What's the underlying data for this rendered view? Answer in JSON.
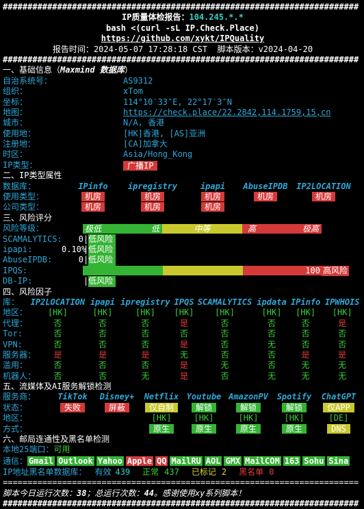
{
  "header": {
    "title_prefix": "IP质量体检报告：",
    "ip": "104.245.*.*",
    "cmd": "bash <(curl -sL IP.Check.Place)",
    "repo": "https://github.com/xykt/IPQuality",
    "report_time_label": "报告时间：",
    "report_time": "2024-05-07 17:28:18 CST",
    "version_label": "脚本版本：",
    "version": "v2024-04-20"
  },
  "basic": {
    "title": "一、基础信息（",
    "title_em": "Maxmind 数据库",
    "title_end": "）",
    "rows": [
      {
        "label": "自治系统号：",
        "value": "AS9312"
      },
      {
        "label": "组织：",
        "value": "xTom"
      },
      {
        "label": "坐标：",
        "value": "114°10′33″E, 22°17′3″N"
      },
      {
        "label": "地图：",
        "value": "https://check.place/22.2842,114.1759,15,cn"
      },
      {
        "label": "城市：",
        "value": "N/A, 香港"
      },
      {
        "label": "使用地：",
        "value": "[HK]香港, [AS]亚洲"
      },
      {
        "label": "注册地：",
        "value": "[CA]加拿大"
      },
      {
        "label": "时区：",
        "value": "Asia/Hong_Kong"
      },
      {
        "label": "IP类型：",
        "value": "广播IP"
      }
    ]
  },
  "iptype": {
    "title": "二、IP类型属性",
    "db_label": "数据库：",
    "dbs": [
      "IPinfo",
      "ipregistry",
      "ipapi",
      "AbuseIPDB",
      "IP2LOCATION"
    ],
    "use_label": "使用类型：",
    "use": [
      "机房",
      "机房",
      "机房",
      "机房",
      "机房"
    ],
    "company_label": "公司类型：",
    "company": [
      "机房",
      "机房",
      "机房",
      "",
      ""
    ]
  },
  "risk": {
    "title": "三、风险评分",
    "level_label": "风险等级：",
    "levels": [
      "极低",
      "低",
      "中等",
      "高",
      "极高"
    ],
    "rows": [
      {
        "label": "SCAMALYTICS:",
        "num": "0",
        "text": "低风险",
        "fill": 0.0
      },
      {
        "label": "ipapi:",
        "num": "0.10%",
        "text": "低风险",
        "fill": 0.001
      },
      {
        "label": "AbuseIPDB:",
        "num": "0",
        "text": "低风险",
        "fill": 0.0
      },
      {
        "label": "IPQS:",
        "num": "100",
        "text": "高风险",
        "fill": 1.0
      },
      {
        "label": "DB-IP:",
        "num": "",
        "text": "低风险",
        "fill": 0.0
      }
    ]
  },
  "factors": {
    "title": "四、风险因子",
    "lib_label": "库：",
    "cols": [
      "IP2LOCATION",
      "ipapi",
      "ipregistry",
      "IPQS",
      "SCAMALYTICS",
      "ipdata",
      "IPinfo",
      "IPWHOIS"
    ],
    "rows": [
      {
        "label": "地区：",
        "cells": [
          [
            "[HK]",
            "g"
          ],
          [
            "[HK]",
            "g"
          ],
          [
            "[HK]",
            "g"
          ],
          [
            "[HK]",
            "g"
          ],
          [
            "[HK]",
            "g"
          ],
          [
            "[HK]",
            "g"
          ],
          [
            "[HK]",
            "g"
          ],
          [
            "[HK]",
            "g"
          ]
        ]
      },
      {
        "label": "代理：",
        "cells": [
          [
            "否",
            "g"
          ],
          [
            "否",
            "g"
          ],
          [
            "否",
            "g"
          ],
          [
            "是",
            "r"
          ],
          [
            "否",
            "g"
          ],
          [
            "否",
            "g"
          ],
          [
            "否",
            "g"
          ],
          [
            "是",
            "r"
          ]
        ]
      },
      {
        "label": "Tor:",
        "cells": [
          [
            "否",
            "g"
          ],
          [
            "否",
            "g"
          ],
          [
            "否",
            "g"
          ],
          [
            "否",
            "g"
          ],
          [
            "否",
            "g"
          ],
          [
            "否",
            "g"
          ],
          [
            "否",
            "g"
          ],
          [
            "否",
            "g"
          ]
        ]
      },
      {
        "label": "VPN:",
        "cells": [
          [
            "否",
            "g"
          ],
          [
            "否",
            "g"
          ],
          [
            "否",
            "g"
          ],
          [
            "是",
            "r"
          ],
          [
            "否",
            "g"
          ],
          [
            "无",
            "g"
          ],
          [
            "否",
            "g"
          ],
          [
            "否",
            "g"
          ]
        ]
      },
      {
        "label": "服务器：",
        "cells": [
          [
            "是",
            "r"
          ],
          [
            "是",
            "r"
          ],
          [
            "是",
            "r"
          ],
          [
            "无",
            "g"
          ],
          [
            "否",
            "g"
          ],
          [
            "否",
            "g"
          ],
          [
            "是",
            "r"
          ],
          [
            "是",
            "r"
          ]
        ]
      },
      {
        "label": "滥用：",
        "cells": [
          [
            "否",
            "g"
          ],
          [
            "否",
            "g"
          ],
          [
            "否",
            "g"
          ],
          [
            "是",
            "r"
          ],
          [
            "无",
            "g"
          ],
          [
            "否",
            "g"
          ],
          [
            "无",
            "g"
          ],
          [
            "无",
            "g"
          ]
        ]
      },
      {
        "label": "机器人：",
        "cells": [
          [
            "否",
            "g"
          ],
          [
            "否",
            "g"
          ],
          [
            "无",
            "g"
          ],
          [
            "是",
            "r"
          ],
          [
            "否",
            "g"
          ],
          [
            "无",
            "g"
          ],
          [
            "无",
            "g"
          ],
          [
            "无",
            "g"
          ]
        ]
      }
    ]
  },
  "stream": {
    "title": "五、流媒体及AI服务解锁检测",
    "svc_label": "服务商：",
    "services": [
      "TikTok",
      "Disney+",
      "Netflix",
      "Youtube",
      "AmazonPV",
      "Spotify",
      "ChatGPT"
    ],
    "status_label": "状态：",
    "status": [
      [
        "失败",
        "red"
      ],
      [
        "屏蔽",
        "red"
      ],
      [
        "仅自制",
        "yellow"
      ],
      [
        "解锁",
        "green"
      ],
      [
        "解锁",
        "green"
      ],
      [
        "解锁",
        "green"
      ],
      [
        "仅APP",
        "yellow"
      ]
    ],
    "region_label": "地区：",
    "region": [
      "",
      "",
      "[HK]",
      "[HK]",
      "[HK]",
      "[HK]",
      "[DE]"
    ],
    "method_label": "方式：",
    "method": [
      [
        "",
        ""
      ],
      [
        "",
        ""
      ],
      [
        "原生",
        "green"
      ],
      [
        "原生",
        "green"
      ],
      [
        "原生",
        "green"
      ],
      [
        "原生",
        "green"
      ],
      [
        "DNS",
        "yellow"
      ]
    ]
  },
  "mail": {
    "title": "六、邮局连通性及黑名单检测",
    "port_label": "本地25端口：",
    "port_value": "可用",
    "comm_label": "通信：",
    "providers": [
      [
        "Gmail",
        "green"
      ],
      [
        "Outlook",
        "green"
      ],
      [
        "Yahoo",
        "green"
      ],
      [
        "Apple",
        "red"
      ],
      [
        "QQ",
        "red"
      ],
      [
        "MailRU",
        "green"
      ],
      [
        "AOL",
        "green"
      ],
      [
        "GMX",
        "green"
      ],
      [
        "MailCOM",
        "green"
      ],
      [
        "163",
        "green"
      ],
      [
        "Sohu",
        "green"
      ],
      [
        "Sina",
        "green"
      ]
    ],
    "bl_label": "IP地址黑名单数据库：",
    "valid_label": "有效",
    "valid": "439",
    "normal_label": "正常",
    "normal": "437",
    "marked_label": "已标记",
    "marked": "2",
    "black_label": "黑名单",
    "black": "0"
  },
  "footer": {
    "p1": "脚本今日运行次数：",
    "today": "38",
    "p2": "；总运行次数：",
    "total": "44",
    "p3": "。感谢使用xy系列脚本！"
  }
}
